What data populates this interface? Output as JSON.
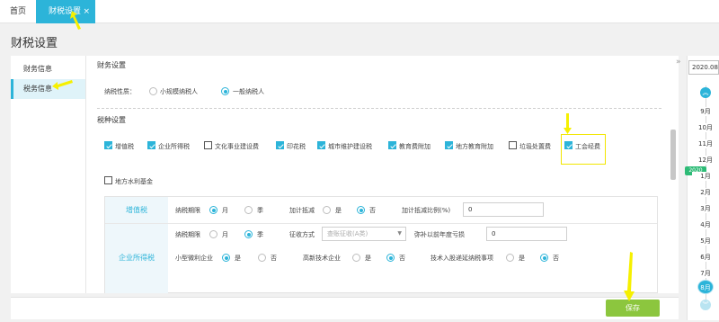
{
  "tabs": {
    "home": "首页",
    "active": "财税设置",
    "close": "×"
  },
  "page_title": "财税设置",
  "sidebar": {
    "items": [
      {
        "label": "财务信息"
      },
      {
        "label": "税务信息"
      }
    ]
  },
  "finance": {
    "section_title": "财务设置",
    "taxpayer_label": "纳税性质：",
    "options": [
      "小规模纳税人",
      "一般纳税人"
    ],
    "selected": "一般纳税人"
  },
  "tax_types": {
    "section_title": "税种设置",
    "items": [
      {
        "label": "增值税",
        "checked": true
      },
      {
        "label": "企业所得税",
        "checked": true
      },
      {
        "label": "文化事业建设费",
        "checked": false
      },
      {
        "label": "印花税",
        "checked": true
      },
      {
        "label": "城市维护建设税",
        "checked": true
      },
      {
        "label": "教育费附加",
        "checked": true
      },
      {
        "label": "地方教育附加",
        "checked": true
      },
      {
        "label": "垃圾处置费",
        "checked": false
      },
      {
        "label": "工会经费",
        "checked": true
      },
      {
        "label": "地方水利基金",
        "checked": false
      }
    ]
  },
  "vat": {
    "name": "增值税",
    "period_label": "纳税期限",
    "month": "月",
    "quarter": "季",
    "period_selected": "月",
    "deduct_label": "加计抵减",
    "yes": "是",
    "no": "否",
    "deduct_selected": "否",
    "ratio_label": "加计抵减比例(%)",
    "ratio_value": "0"
  },
  "cit": {
    "name": "企业所得税",
    "period_label": "纳税期限",
    "month": "月",
    "quarter": "季",
    "period_selected": "季",
    "method_label": "征收方式",
    "method_value": "查账征收(A类)",
    "loss_label": "弥补以前年度亏损",
    "loss_value": "0",
    "small_label": "小型微利企业",
    "small_selected": "是",
    "hightech_label": "高新技术企业",
    "hightech_selected": "否",
    "tech_label": "技术入股递延纳税事项",
    "tech_selected": "否",
    "yes": "是",
    "no": "否"
  },
  "save_button": "保存",
  "right_panel": {
    "date_value": "2020.08",
    "year_badge": "2020",
    "months": [
      "9月",
      "10月",
      "11月",
      "12月",
      "1月",
      "2月",
      "3月",
      "4月",
      "5月",
      "6月",
      "7月",
      "8月"
    ],
    "current_month": "8月"
  },
  "colors": {
    "accent": "#2cb4d9",
    "save": "#8cc63e",
    "year_badge": "#2dbb76",
    "annotation": "#f6f000"
  }
}
